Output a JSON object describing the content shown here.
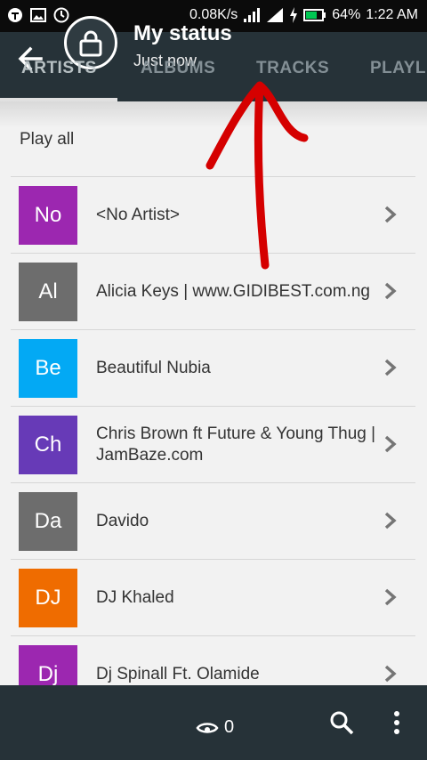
{
  "status_bar": {
    "speed": "0.08K/s",
    "battery": "64%",
    "time": "1:22 AM",
    "icons": [
      "t-app-icon",
      "image-icon",
      "clock-icon",
      "signal-icon",
      "signal-icon",
      "charging-icon",
      "battery-icon"
    ]
  },
  "header": {
    "title": "My status",
    "subtitle": "Just now",
    "background": "#263238",
    "tabs": [
      {
        "label": "ARTISTS"
      },
      {
        "label": "ALBUMS"
      },
      {
        "label": "TRACKS"
      },
      {
        "label": "PLAYLI"
      }
    ]
  },
  "play_all": "Play all",
  "artists": [
    {
      "initials": "No",
      "name": "<No Artist>",
      "color": "#9c27b0"
    },
    {
      "initials": "Al",
      "name": "Alicia Keys | www.GIDIBEST.com.ng",
      "color": "#6d6d6d"
    },
    {
      "initials": "Be",
      "name": "Beautiful Nubia",
      "color": "#03a9f4"
    },
    {
      "initials": "Ch",
      "name": "Chris Brown ft Future & Young Thug | JamBaze.com",
      "color": "#673ab7"
    },
    {
      "initials": "Da",
      "name": "Davido",
      "color": "#6d6d6d"
    },
    {
      "initials": "DJ",
      "name": "DJ Khaled",
      "color": "#ef6c00"
    },
    {
      "initials": "Dj",
      "name": "Dj Spinall Ft. Olamide",
      "color": "#9c27b0"
    }
  ],
  "bottom_bar": {
    "view_count": "0"
  },
  "annotation_color": "#d50000"
}
